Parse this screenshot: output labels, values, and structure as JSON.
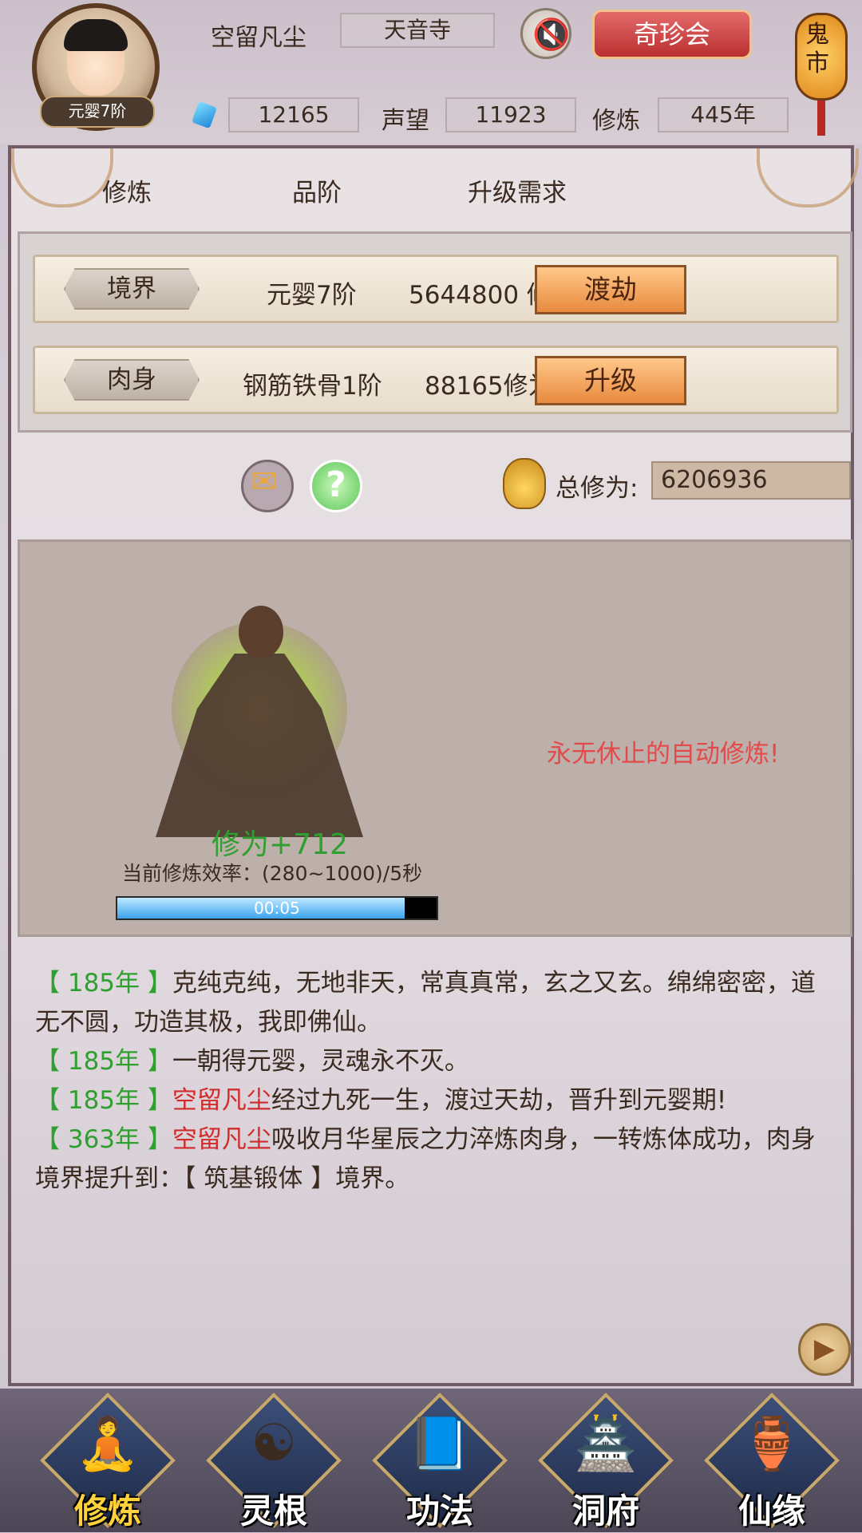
{
  "header": {
    "player_name": "空留凡尘",
    "sect": "天音寺",
    "realm_badge": "元婴7阶",
    "currency": "12165",
    "reputation_label": "声望",
    "reputation": "11923",
    "cultivation_label": "修炼",
    "cultivation_years": "445年",
    "treasure_button": "奇珍会",
    "ghost_market": "鬼市",
    "icons": {
      "sound": "muted-speaker-icon",
      "currency": "spirit-gem-icon"
    }
  },
  "tabs": [
    "修炼",
    "品阶",
    "升级需求"
  ],
  "upgrades": [
    {
      "label": "境界",
      "grade": "元婴7阶",
      "requirement": "5644800 修为",
      "action": "渡劫"
    },
    {
      "label": "肉身",
      "grade": "钢筋铁骨1阶",
      "requirement": "88165修为",
      "action": "升级"
    }
  ],
  "total": {
    "label": "总修为:",
    "value": "6206936"
  },
  "cultivation": {
    "gain": "修为+712",
    "rate": "当前修炼效率：(280~1000)/5秒",
    "timer": "00:05",
    "progress": 0.9,
    "auto_text": "永无休止的自动修炼!"
  },
  "log": [
    {
      "year": "【 185年 】",
      "name": "",
      "text": "克纯克纯，无地非天，常真真常，玄之又玄。绵绵密密，道无不圆，功造其极，我即佛仙。"
    },
    {
      "year": "【 185年 】",
      "name": "",
      "text": "一朝得元婴，灵魂永不灭。"
    },
    {
      "year": "【 185年 】",
      "name": "空留凡尘",
      "text": "经过九死一生，渡过天劫，晋升到元婴期!"
    },
    {
      "year": "【 363年 】",
      "name": "空留凡尘",
      "text": "吸收月华星辰之力淬炼肉身，一转炼体成功，肉身境界提升到：【 筑基锻体 】境界。"
    }
  ],
  "nav": [
    {
      "label": "修炼",
      "icon": "meditating-monk-icon",
      "active": true
    },
    {
      "label": "灵根",
      "icon": "yin-yang-sword-icon",
      "active": false
    },
    {
      "label": "功法",
      "icon": "scripture-book-icon",
      "active": false
    },
    {
      "label": "洞府",
      "icon": "pagoda-icon",
      "active": false
    },
    {
      "label": "仙缘",
      "icon": "gourd-icon",
      "active": false
    }
  ],
  "colors": {
    "accent_red": "#d12b2b",
    "accent_green": "#2fa02f",
    "button_orange": "#e88a3e"
  }
}
